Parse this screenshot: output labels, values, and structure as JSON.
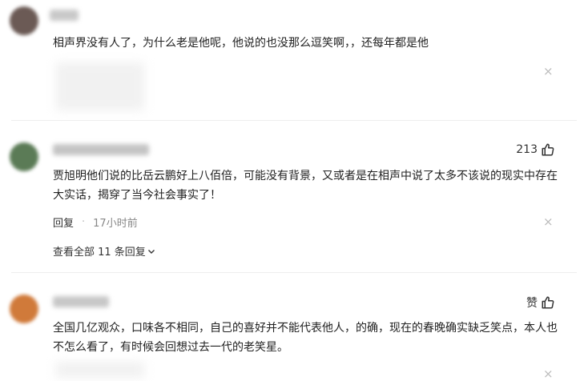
{
  "comments": [
    {
      "text": "相声界没有人了，为什么老是他呢，他说的也没那么逗笑啊，，还每年都是他",
      "close_icon": "×"
    },
    {
      "likes": "213",
      "text": "贾旭明他们说的比岳云鹏好上八佰倍，可能没有背景，又或者是在相声中说了太多不该说的现实中存在大实话，揭穿了当今社会事实了！",
      "reply_label": "回复",
      "time": "17小时前",
      "view_replies": "查看全部 11 条回复",
      "close_icon": "×"
    },
    {
      "likes": "赞",
      "text": "全国几亿观众，口味各不相同，自己的喜好并不能代表他人，的确，现在的春晚确实缺乏笑点，本人也不怎么看了，有时候会回想过去一代的老笑星。",
      "close_icon": "×"
    }
  ],
  "icons": {
    "like": "thumbs-up-icon",
    "chevron": "chevron-down-icon",
    "close": "close-icon"
  }
}
